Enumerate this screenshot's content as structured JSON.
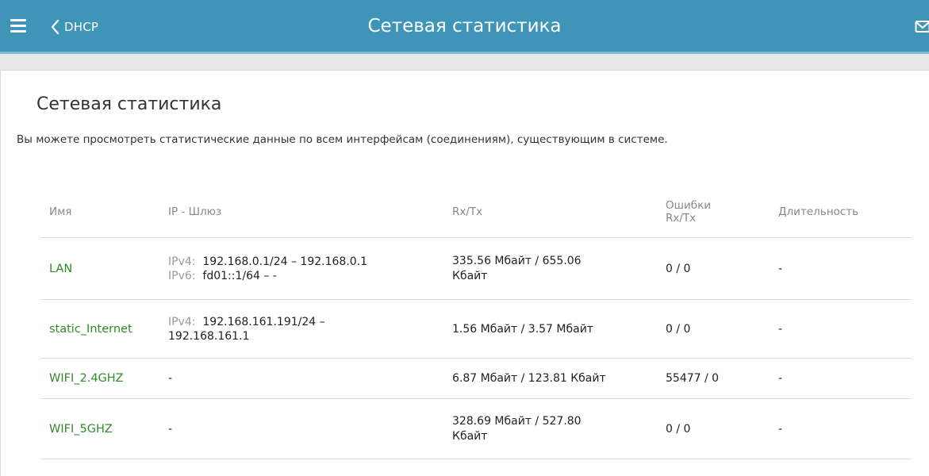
{
  "header": {
    "back_label": "DHCP",
    "title": "Сетевая статистика"
  },
  "page": {
    "heading": "Сетевая статистика",
    "description": "Вы можете просмотреть статистические данные по всем интерфейсам (соединениям), существующим в системе."
  },
  "table": {
    "columns": {
      "name": "Имя",
      "ip": "IP - Шлюз",
      "rxtx": "Rx/Tx",
      "errors_line1": "Ошибки",
      "errors_line2": "Rx/Tx",
      "duration": "Длительность"
    },
    "rows": [
      {
        "name": "LAN",
        "ip": [
          {
            "prefix": "IPv4:",
            "value": "192.168.0.1/24 – 192.168.0.1"
          },
          {
            "prefix": "IPv6:",
            "value": "fd01::1/64 –  -"
          }
        ],
        "rxtx_line1": "335.56 Мбайт / 655.06",
        "rxtx_line2": "Кбайт",
        "errors": "0 / 0",
        "duration": "-"
      },
      {
        "name": "static_Internet",
        "ip": [
          {
            "prefix": "IPv4:",
            "value": "192.168.161.191/24 –"
          }
        ],
        "ip_cont": "192.168.161.1",
        "rxtx": "1.56 Мбайт / 3.57 Мбайт",
        "errors": "0 / 0",
        "duration": "-"
      },
      {
        "name": "WIFI_2.4GHZ",
        "ip_text": "-",
        "rxtx": "6.87 Мбайт / 123.81 Кбайт",
        "errors": "55477 / 0",
        "duration": "-"
      },
      {
        "name": "WIFI_5GHZ",
        "ip_text": "-",
        "rxtx_line1": "328.69 Мбайт / 527.80",
        "rxtx_line2": "Кбайт",
        "errors": "0 / 0",
        "duration": "-"
      }
    ]
  },
  "icons": {
    "menu": "hamburger-menu-icon",
    "back": "chevron-left-icon",
    "mail": "mail-icon"
  },
  "colors": {
    "header_bg": "#3f95b8",
    "link_green": "#2f8a2a"
  }
}
